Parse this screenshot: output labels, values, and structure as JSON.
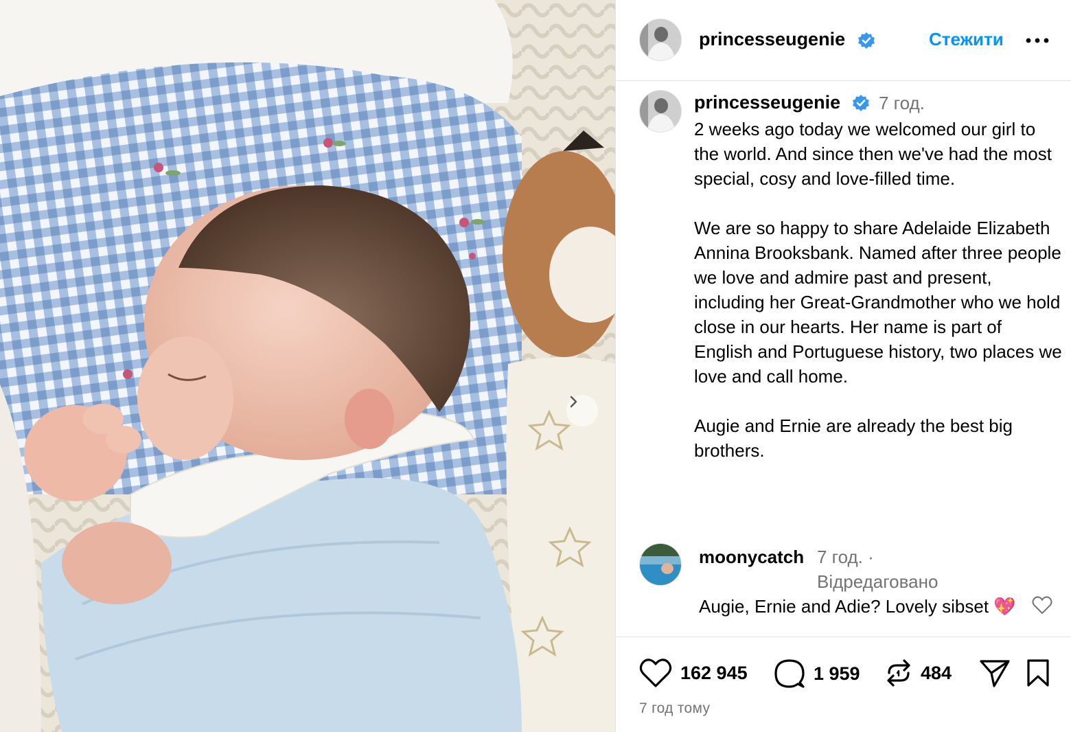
{
  "post": {
    "image_alt": "Newborn baby sleeping swaddled in a blue blanket on a gingham pillow",
    "next_icon": "chevron-right-icon"
  },
  "header": {
    "username": "princesseugenie",
    "follow_label": "Стежити",
    "more_icon": "ellipsis-icon"
  },
  "caption": {
    "username": "princesseugenie",
    "time": "7 год.",
    "paragraphs": [
      "2 weeks ago today we welcomed our girl to the world. And since then we've had the most special, cosy and love-filled time.",
      "We are so happy to share Adelaide Elizabeth Annina Brooksbank. Named after three people we love and admire past and present, including her Great-Grandmother who we hold close in our hearts. Her name is part of English and Portuguese history, two places we love and call home.",
      "Augie and Ernie are already the best big brothers."
    ]
  },
  "comment": {
    "username": "moonycatch",
    "time": "7 год. ·",
    "edited": "Відредаговано",
    "text": "Augie, Ernie and Adie? Lovely sibset 💖"
  },
  "actions": {
    "likes": "162 945",
    "comments": "1 959",
    "reposts": "484",
    "posted": "7 год тому"
  },
  "colors": {
    "accent": "#0095f6",
    "muted": "#737373",
    "verified": "#3897f0"
  }
}
